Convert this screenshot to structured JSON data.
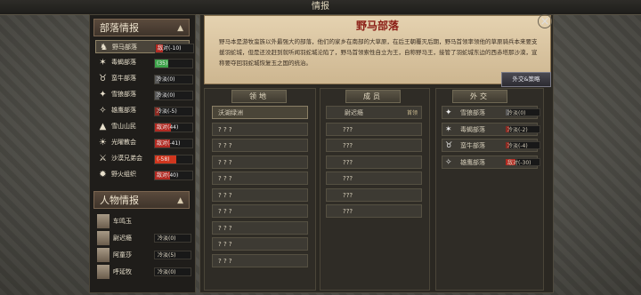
{
  "window": {
    "title": "情报"
  },
  "left": {
    "tribes_header": "部落情报",
    "tribes": [
      {
        "icon": "horse-icon",
        "name": "野马部落",
        "status": "敌对(-10)",
        "color": "#b22a22",
        "level": 0.2,
        "selected": true
      },
      {
        "icon": "scorpion-icon",
        "name": "毒蝎部落",
        "status": "(35)",
        "color": "#3da34a",
        "level": 0.35,
        "selected": false
      },
      {
        "icon": "bull-icon",
        "name": "蛮牛部落",
        "status": "冷淡(0)",
        "color": "#5a5a5a",
        "level": 0.0,
        "selected": false
      },
      {
        "icon": "wolf-icon",
        "name": "雪狼部落",
        "status": "冷淡(0)",
        "color": "#5a5a5a",
        "level": 0.0,
        "selected": false
      },
      {
        "icon": "eagle-icon",
        "name": "雄鹰部落",
        "status": "冷淡(-5)",
        "color": "#8a2a22",
        "level": 0.05,
        "selected": false
      },
      {
        "icon": "mountain-icon",
        "name": "雪山山民",
        "status": "敌对(44)",
        "color": "#b22a22",
        "level": 0.44,
        "selected": false
      },
      {
        "icon": "sun-icon",
        "name": "光曜教会",
        "status": "敌对(-41)",
        "color": "#b22a22",
        "level": 0.41,
        "selected": false
      },
      {
        "icon": "swords-icon",
        "name": "沙漠兄弟会",
        "status": "(-58)",
        "color": "#d0361e",
        "level": 0.58,
        "selected": false
      },
      {
        "icon": "fire-icon",
        "name": "野火组织",
        "status": "敌对(40)",
        "color": "#b22a22",
        "level": 0.4,
        "selected": false
      }
    ],
    "people_header": "人物情报",
    "people": [
      {
        "name": "车鸣玉",
        "status": ""
      },
      {
        "name": "尉迟瘾",
        "status": "冷淡(0)"
      },
      {
        "name": "阿童莎",
        "status": "冷淡(5)"
      },
      {
        "name": "呼延牧",
        "status": "冷淡(0)"
      }
    ]
  },
  "detail": {
    "title": "野马部落",
    "description": "野马本是游牧蛮族以外最强大的部落，他们的家乡在南部的大草原，在后王朝覆灭后期，野马首领率领他的草原骑兵本来要支援羽蛇城，但是还没赶到就听闻羽蛇城沦陷了，野马首领索性自立为王，自称野马王，接管了羽蛇城东边的西赤塔那沙漠，宣称要夺回羽蛇城恢复玉之国的统治。",
    "diplomacy_button": "外交&策略",
    "territory": {
      "header": "领地",
      "items": [
        "沃湖绿洲",
        "? ? ?",
        "? ? ?",
        "? ? ?",
        "? ? ?",
        "? ? ?",
        "? ? ?",
        "? ? ?",
        "? ? ?",
        "? ? ?"
      ]
    },
    "members": {
      "header": "成员",
      "items": [
        {
          "name": "尉迟瘾",
          "tag": "首领"
        },
        {
          "name": "???"
        },
        {
          "name": "???"
        },
        {
          "name": "???"
        },
        {
          "name": "???"
        },
        {
          "name": "???"
        },
        {
          "name": "???"
        }
      ]
    },
    "diplomacy": {
      "header": "外交",
      "items": [
        {
          "icon": "wolf-icon",
          "name": "雪狼部落",
          "status": "冷淡(0)",
          "color": "#5a5a5a",
          "level": 0.0
        },
        {
          "icon": "scorpion-icon",
          "name": "毒蝎部落",
          "status": "冷淡(-2)",
          "color": "#8a2a22",
          "level": 0.02
        },
        {
          "icon": "bull-icon",
          "name": "蛮牛部落",
          "status": "冷淡(-4)",
          "color": "#8a2a22",
          "level": 0.04
        },
        {
          "icon": "eagle-icon",
          "name": "雄鹰部落",
          "status": "敌对(-30)",
          "color": "#b22a22",
          "level": 0.3
        }
      ]
    }
  }
}
